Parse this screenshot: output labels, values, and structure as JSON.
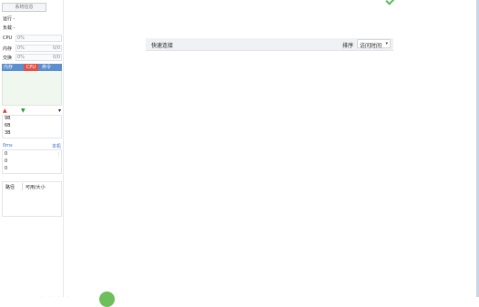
{
  "sidebar": {
    "system_info_button": "系统信息",
    "run_label": "运行 -",
    "load_label": "负载 -",
    "meters": [
      {
        "label": "CPU",
        "percent": "0%",
        "ratio": ""
      },
      {
        "label": "内存",
        "percent": "0%",
        "ratio": "0/0"
      },
      {
        "label": "交换",
        "percent": "0%",
        "ratio": "0/0"
      }
    ],
    "process_table": {
      "col_memory": "内存",
      "col_cpu": "CPU",
      "col_command": "命令"
    },
    "network": {
      "up_icon": "up-arrow-icon",
      "down_icon": "down-arrow-icon",
      "dropdown_icon": "dropdown-caret-icon",
      "scale": [
        "9B",
        "6B",
        "3B"
      ]
    },
    "ping": {
      "latency_label": "0ms",
      "host_label": "本机",
      "values": [
        "0",
        "0",
        "0"
      ]
    },
    "disk": {
      "col_path": "路径",
      "col_available": "可用/大小"
    }
  },
  "main": {
    "quick_connect": {
      "title": "快速连接",
      "sort_label": "排序",
      "sort_value": "访问时间"
    }
  },
  "colors": {
    "accent_blue": "#5b8fd0",
    "cpu_red": "#e0534a",
    "ok_green": "#6cbf5a"
  }
}
